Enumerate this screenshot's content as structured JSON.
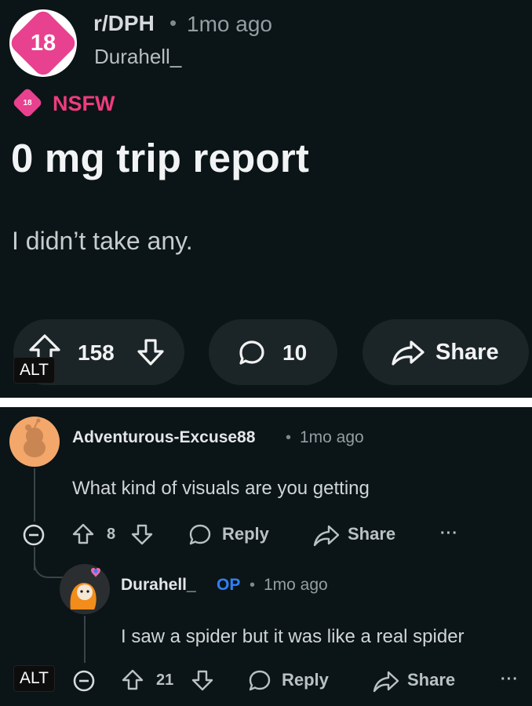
{
  "post": {
    "subreddit_icon_text": "18",
    "subreddit": "r/DPH",
    "separator": "•",
    "time": "1mo ago",
    "author": "Durahell_",
    "nsfw_icon_text": "18",
    "nsfw_label": "NSFW",
    "title": "0 mg trip report",
    "body": "I didn’t take any.",
    "votes": "158",
    "comments": "10",
    "share_label": "Share",
    "alt_text": "ALT"
  },
  "comments": [
    {
      "author": "Adventurous-Excuse88",
      "separator": "•",
      "time": "1mo ago",
      "body": "What kind of visuals are you getting",
      "votes": "8",
      "reply_label": "Reply",
      "share_label": "Share",
      "more_label": "···"
    },
    {
      "author": "Durahell_",
      "op_badge": "OP",
      "separator": "•",
      "time": "1mo ago",
      "body": "I saw a spider but it was like a real spider",
      "votes": "21",
      "reply_label": "Reply",
      "share_label": "Share",
      "more_label": "···"
    }
  ],
  "comments_alt_text": "ALT",
  "colors": {
    "background": "#0b1416",
    "nsfw_pink": "#ef3b7f",
    "op_blue": "#2f81f7",
    "pill": "#1b2528"
  }
}
